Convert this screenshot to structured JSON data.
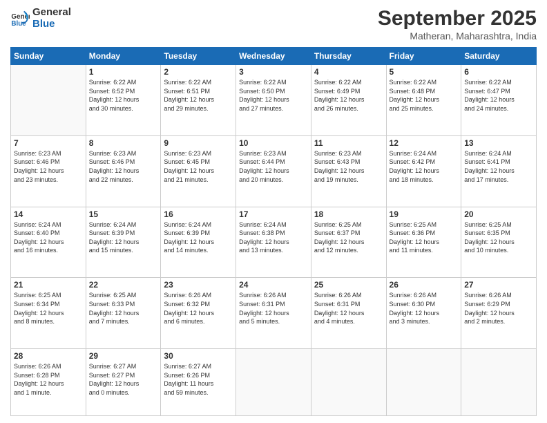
{
  "logo": {
    "line1": "General",
    "line2": "Blue"
  },
  "title": "September 2025",
  "location": "Matheran, Maharashtra, India",
  "weekdays": [
    "Sunday",
    "Monday",
    "Tuesday",
    "Wednesday",
    "Thursday",
    "Friday",
    "Saturday"
  ],
  "weeks": [
    [
      {
        "day": "",
        "info": ""
      },
      {
        "day": "1",
        "info": "Sunrise: 6:22 AM\nSunset: 6:52 PM\nDaylight: 12 hours\nand 30 minutes."
      },
      {
        "day": "2",
        "info": "Sunrise: 6:22 AM\nSunset: 6:51 PM\nDaylight: 12 hours\nand 29 minutes."
      },
      {
        "day": "3",
        "info": "Sunrise: 6:22 AM\nSunset: 6:50 PM\nDaylight: 12 hours\nand 27 minutes."
      },
      {
        "day": "4",
        "info": "Sunrise: 6:22 AM\nSunset: 6:49 PM\nDaylight: 12 hours\nand 26 minutes."
      },
      {
        "day": "5",
        "info": "Sunrise: 6:22 AM\nSunset: 6:48 PM\nDaylight: 12 hours\nand 25 minutes."
      },
      {
        "day": "6",
        "info": "Sunrise: 6:22 AM\nSunset: 6:47 PM\nDaylight: 12 hours\nand 24 minutes."
      }
    ],
    [
      {
        "day": "7",
        "info": "Sunrise: 6:23 AM\nSunset: 6:46 PM\nDaylight: 12 hours\nand 23 minutes."
      },
      {
        "day": "8",
        "info": "Sunrise: 6:23 AM\nSunset: 6:46 PM\nDaylight: 12 hours\nand 22 minutes."
      },
      {
        "day": "9",
        "info": "Sunrise: 6:23 AM\nSunset: 6:45 PM\nDaylight: 12 hours\nand 21 minutes."
      },
      {
        "day": "10",
        "info": "Sunrise: 6:23 AM\nSunset: 6:44 PM\nDaylight: 12 hours\nand 20 minutes."
      },
      {
        "day": "11",
        "info": "Sunrise: 6:23 AM\nSunset: 6:43 PM\nDaylight: 12 hours\nand 19 minutes."
      },
      {
        "day": "12",
        "info": "Sunrise: 6:24 AM\nSunset: 6:42 PM\nDaylight: 12 hours\nand 18 minutes."
      },
      {
        "day": "13",
        "info": "Sunrise: 6:24 AM\nSunset: 6:41 PM\nDaylight: 12 hours\nand 17 minutes."
      }
    ],
    [
      {
        "day": "14",
        "info": "Sunrise: 6:24 AM\nSunset: 6:40 PM\nDaylight: 12 hours\nand 16 minutes."
      },
      {
        "day": "15",
        "info": "Sunrise: 6:24 AM\nSunset: 6:39 PM\nDaylight: 12 hours\nand 15 minutes."
      },
      {
        "day": "16",
        "info": "Sunrise: 6:24 AM\nSunset: 6:39 PM\nDaylight: 12 hours\nand 14 minutes."
      },
      {
        "day": "17",
        "info": "Sunrise: 6:24 AM\nSunset: 6:38 PM\nDaylight: 12 hours\nand 13 minutes."
      },
      {
        "day": "18",
        "info": "Sunrise: 6:25 AM\nSunset: 6:37 PM\nDaylight: 12 hours\nand 12 minutes."
      },
      {
        "day": "19",
        "info": "Sunrise: 6:25 AM\nSunset: 6:36 PM\nDaylight: 12 hours\nand 11 minutes."
      },
      {
        "day": "20",
        "info": "Sunrise: 6:25 AM\nSunset: 6:35 PM\nDaylight: 12 hours\nand 10 minutes."
      }
    ],
    [
      {
        "day": "21",
        "info": "Sunrise: 6:25 AM\nSunset: 6:34 PM\nDaylight: 12 hours\nand 8 minutes."
      },
      {
        "day": "22",
        "info": "Sunrise: 6:25 AM\nSunset: 6:33 PM\nDaylight: 12 hours\nand 7 minutes."
      },
      {
        "day": "23",
        "info": "Sunrise: 6:26 AM\nSunset: 6:32 PM\nDaylight: 12 hours\nand 6 minutes."
      },
      {
        "day": "24",
        "info": "Sunrise: 6:26 AM\nSunset: 6:31 PM\nDaylight: 12 hours\nand 5 minutes."
      },
      {
        "day": "25",
        "info": "Sunrise: 6:26 AM\nSunset: 6:31 PM\nDaylight: 12 hours\nand 4 minutes."
      },
      {
        "day": "26",
        "info": "Sunrise: 6:26 AM\nSunset: 6:30 PM\nDaylight: 12 hours\nand 3 minutes."
      },
      {
        "day": "27",
        "info": "Sunrise: 6:26 AM\nSunset: 6:29 PM\nDaylight: 12 hours\nand 2 minutes."
      }
    ],
    [
      {
        "day": "28",
        "info": "Sunrise: 6:26 AM\nSunset: 6:28 PM\nDaylight: 12 hours\nand 1 minute."
      },
      {
        "day": "29",
        "info": "Sunrise: 6:27 AM\nSunset: 6:27 PM\nDaylight: 12 hours\nand 0 minutes."
      },
      {
        "day": "30",
        "info": "Sunrise: 6:27 AM\nSunset: 6:26 PM\nDaylight: 11 hours\nand 59 minutes."
      },
      {
        "day": "",
        "info": ""
      },
      {
        "day": "",
        "info": ""
      },
      {
        "day": "",
        "info": ""
      },
      {
        "day": "",
        "info": ""
      }
    ]
  ]
}
